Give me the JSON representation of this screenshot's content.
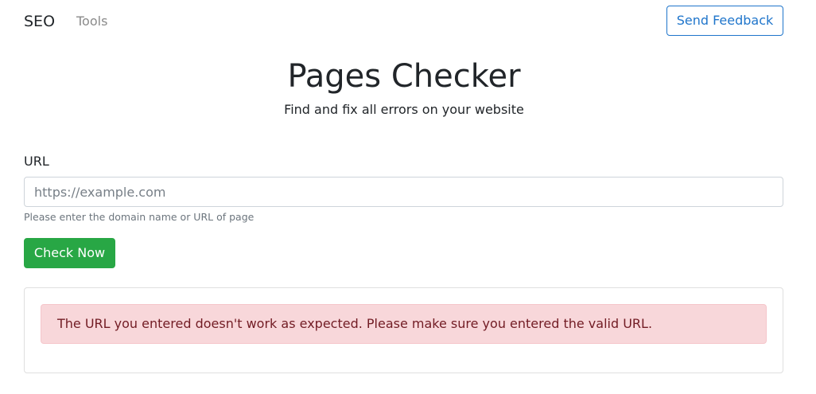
{
  "navbar": {
    "brand": "SEO",
    "tools_link": "Tools",
    "feedback_button": "Send Feedback"
  },
  "header": {
    "title": "Pages Checker",
    "subtitle": "Find and fix all errors on your website"
  },
  "form": {
    "url_label": "URL",
    "url_value": "",
    "url_placeholder": "https://example.com",
    "help_text": "Please enter the domain name or URL of page",
    "submit_button": "Check Now"
  },
  "result": {
    "error_message": "The URL you entered doesn't work as expected. Please make sure you entered the valid URL."
  },
  "colors": {
    "primary": "#1f75cb",
    "success": "#28a745",
    "danger_bg": "#f8d7da",
    "danger_text": "#721c24"
  }
}
